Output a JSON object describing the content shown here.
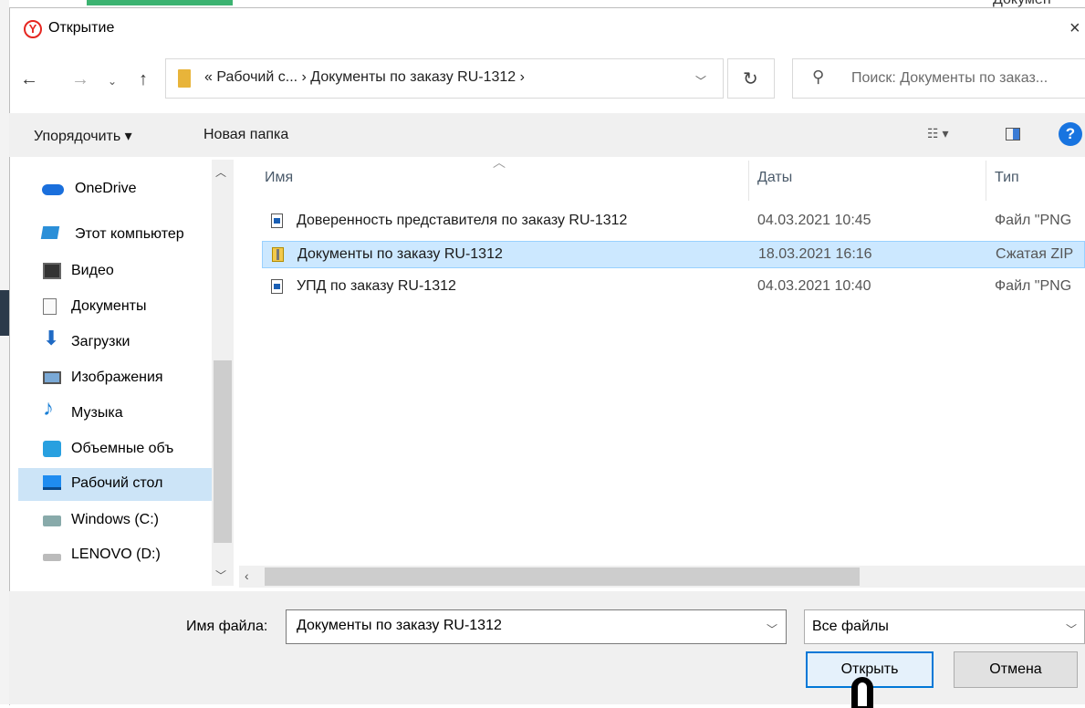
{
  "dialog": {
    "title": "Открытие",
    "close_glyph": "×"
  },
  "background": {
    "title_fragment": "Докумен"
  },
  "nav": {
    "back_glyph": "←",
    "forward_glyph": "→",
    "recent_glyph": "⌄",
    "up_glyph": "↑",
    "path": "«  Рабочий с...  ›  Документы по заказу RU-1312  ›",
    "search_placeholder": "Поиск: Документы по заказ...",
    "refresh_glyph": "↻",
    "search_glyph": "⚲"
  },
  "toolbar": {
    "organize": "Упорядочить ▾",
    "new_folder": "Новая папка",
    "view_glyph": "☷ ▾",
    "help_glyph": "?"
  },
  "sidebar": {
    "items": [
      {
        "label": "OneDrive",
        "icon": "onedrive-icon"
      },
      {
        "label": "Этот компьютер",
        "icon": "computer-icon"
      },
      {
        "label": "Видео",
        "icon": "video-icon"
      },
      {
        "label": "Документы",
        "icon": "documents-icon"
      },
      {
        "label": "Загрузки",
        "icon": "downloads-icon",
        "glyph": "⬇"
      },
      {
        "label": "Изображения",
        "icon": "pictures-icon"
      },
      {
        "label": "Музыка",
        "icon": "music-icon",
        "glyph": "♪"
      },
      {
        "label": "Объемные объ",
        "icon": "3d-objects-icon"
      },
      {
        "label": "Рабочий стол",
        "icon": "desktop-icon",
        "selected": true
      },
      {
        "label": "Windows (C:)",
        "icon": "drive-c-icon"
      },
      {
        "label": "LENOVO (D:)",
        "icon": "drive-d-icon"
      }
    ]
  },
  "columns": {
    "name": "Имя",
    "date": "Даты",
    "type": "Тип"
  },
  "files": [
    {
      "name": "Доверенность представителя по заказу RU-1312",
      "date": "04.03.2021 10:45",
      "type": "Файл \"PNG",
      "icon": "png-file-icon"
    },
    {
      "name": "Документы по заказу RU-1312",
      "date": "18.03.2021 16:16",
      "type": "Сжатая ZIP",
      "icon": "zip-file-icon",
      "selected": true
    },
    {
      "name": "УПД по заказу RU-1312",
      "date": "04.03.2021 10:40",
      "type": "Файл \"PNG",
      "icon": "png-file-icon"
    }
  ],
  "bottom": {
    "filename_label": "Имя файла:",
    "filename_value": "Документы по заказу RU-1312",
    "filter_value": "Все файлы",
    "open_button": "Открыть",
    "cancel_button": "Отмена"
  },
  "colors": {
    "accent": "#0078d7",
    "selection": "#cce8ff",
    "app_icon": "#e52620"
  }
}
